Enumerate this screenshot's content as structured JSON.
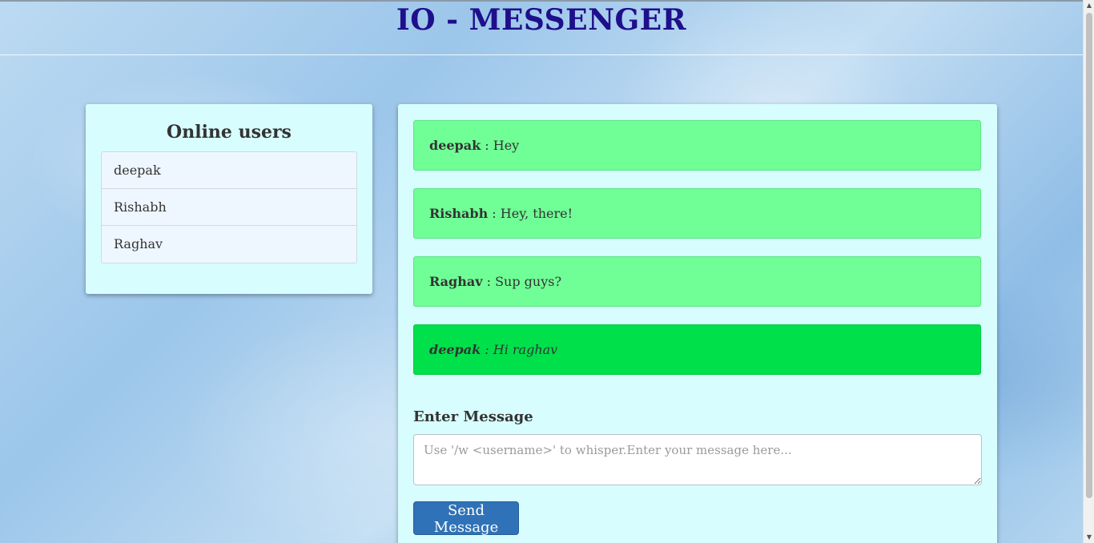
{
  "app": {
    "title": "IO - MESSENGER"
  },
  "users_panel": {
    "title": "Online users",
    "users": [
      "deepak",
      "Rishabh",
      "Raghav"
    ]
  },
  "chat": {
    "messages": [
      {
        "user": "deepak",
        "separator": " : ",
        "text": "Hey",
        "type": "public"
      },
      {
        "user": "Rishabh",
        "separator": " : ",
        "text": "Hey, there!",
        "type": "public"
      },
      {
        "user": "Raghav",
        "separator": " : ",
        "text": "Sup guys?",
        "type": "public"
      },
      {
        "user": "deepak",
        "separator": " : ",
        "text": "Hi raghav",
        "type": "whisper"
      }
    ],
    "input_label": "Enter Message",
    "input_placeholder": "Use '/w <username>' to whisper.Enter your message here...",
    "input_value": "",
    "send_label": "Send Message"
  },
  "colors": {
    "title": "#1e0f8c",
    "panel_bg": "#d7fdff",
    "message_bg": "#70fe96",
    "whisper_bg": "#00e04b",
    "button_bg": "#2f72b7"
  },
  "scrollbar": {
    "up_icon": "scroll-up-arrow-icon",
    "down_icon": "scroll-down-arrow-icon"
  }
}
